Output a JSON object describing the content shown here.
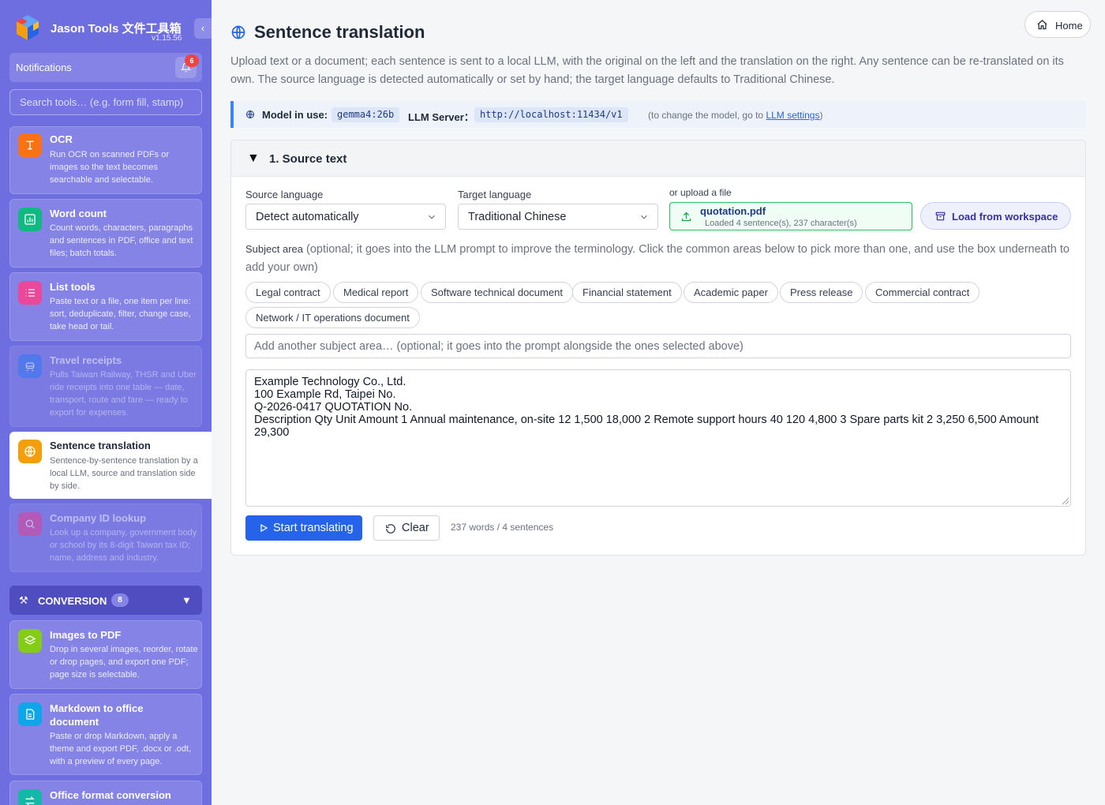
{
  "app": {
    "name": "Jason Tools 文件工具箱",
    "version": "v1.15.56",
    "collapse_glyph": "‹"
  },
  "notifications": {
    "label": "Notifications",
    "count": "6"
  },
  "search": {
    "placeholder": "Search tools… (e.g. form fill, stamp)"
  },
  "tools": [
    {
      "title": "OCR",
      "desc": "Run OCR on scanned PDFs or images so the text becomes searchable and selectable.",
      "icon": "text-t-icon",
      "color": "#f97316"
    },
    {
      "title": "Word count",
      "desc": "Count words, characters, paragraphs and sentences in PDF, office and text files; batch totals.",
      "icon": "bar-chart-icon",
      "color": "#10b981"
    },
    {
      "title": "List tools",
      "desc": "Paste text or a file, one item per line: sort, deduplicate, filter, change case, take head or tail.",
      "icon": "list-icon",
      "color": "#ec4899"
    },
    {
      "title": "Travel receipts",
      "desc": "Pulls Taiwan Railway, THSR and Uber ride receipts into one table — date, transport, route and fare — ready to export for expenses.",
      "icon": "train-icon",
      "color": "#3b82f6"
    },
    {
      "title": "Sentence translation",
      "desc": "Sentence-by-sentence translation by a local LLM, source and translation side by side.",
      "icon": "globe-icon",
      "color": "#f59e0b"
    },
    {
      "title": "Company ID lookup",
      "desc": "Look up a company, government body or school by its 8-digit Taiwan tax ID; name, address and industry.",
      "icon": "search-icon",
      "color": "#ec4899"
    }
  ],
  "category": {
    "label": "CONVERSION",
    "count": "8",
    "chevron": "▼"
  },
  "conversion_tools": [
    {
      "title": "Images to PDF",
      "desc": "Drop in several images, reorder, rotate or drop pages, and export one PDF; page size is selectable.",
      "icon": "layers-icon",
      "color": "#84cc16"
    },
    {
      "title": "Markdown to office document",
      "desc": "Paste or drop Markdown, apply a theme and export PDF, .docx or .odt, with a preview of every page.",
      "icon": "document-icon",
      "color": "#0ea5e9"
    },
    {
      "title": "Office format conversion",
      "desc": "",
      "icon": "swap-icon",
      "color": "#14b8a6"
    }
  ],
  "header": {
    "home_label": "Home"
  },
  "page": {
    "title": "Sentence translation",
    "description": "Upload text or a document; each sentence is sent to a local LLM, with the original on the left and the translation on the right. Any sentence can be re-translated on its own. The source language is detected automatically or set by hand; the target language defaults to Traditional Chinese."
  },
  "model_bar": {
    "model_label": "Model in use:",
    "model_value": "gemma4:26b",
    "server_label": "LLM Server：",
    "server_value": "http://localhost:11434/v1",
    "hint_prefix": "(to change the model, go to ",
    "hint_link": "LLM settings",
    "hint_suffix": ")"
  },
  "source": {
    "section_title": "1. Source text",
    "collapse_glyph": "▼",
    "source_lang_label": "Source language",
    "source_lang_value": "Detect automatically",
    "target_lang_label": "Target language",
    "target_lang_value": "Traditional Chinese",
    "upload_label": "or upload a file",
    "file_name": "quotation.pdf",
    "file_status": "Loaded 4 sentence(s), 237 character(s)",
    "workspace_label": "Load from workspace",
    "subject_label": "Subject area",
    "subject_hint": "(optional; it goes into the LLM prompt to improve the terminology. Click the common areas below to pick more than one, and use the box underneath to add your own)",
    "chips": [
      "Legal contract",
      "Medical report",
      "Software technical document",
      "Financial statement",
      "Academic paper",
      "Press release",
      "Commercial contract",
      "Network / IT operations document"
    ],
    "extra_placeholder": "Add another subject area… (optional; it goes into the prompt alongside the ones selected above)",
    "text": "Example Technology Co., Ltd.\n100 Example Rd, Taipei No.\nQ-2026-0417 QUOTATION No.\nDescription Qty Unit Amount 1 Annual maintenance, on-site 12 1,500 18,000 2 Remote support hours 40 120 4,800 3 Spare parts kit 2 3,250 6,500 Amount 29,300",
    "start_label": "Start translating",
    "clear_label": "Clear",
    "count_text": "237 words / 4 sentences"
  }
}
